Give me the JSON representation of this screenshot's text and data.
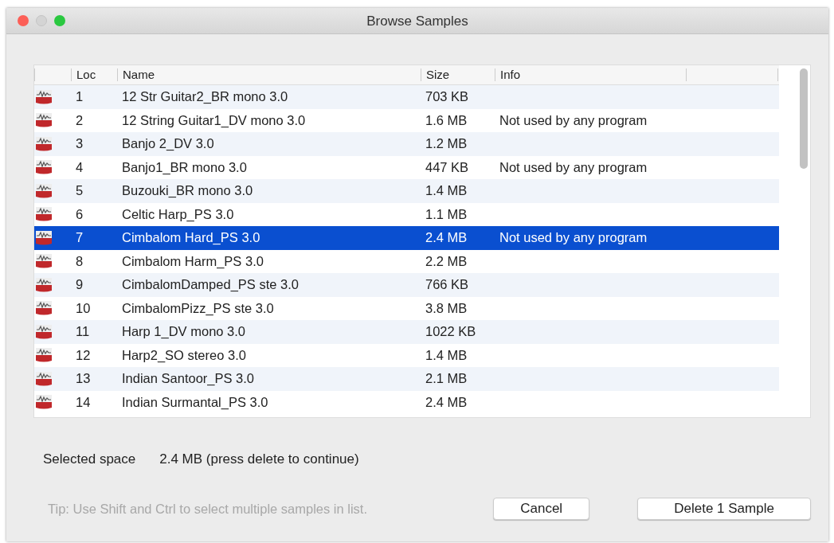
{
  "window": {
    "title": "Browse Samples"
  },
  "table": {
    "columns": [
      "Loc",
      "Name",
      "Size",
      "Info"
    ],
    "rows": [
      {
        "loc": "1",
        "name": "12 Str Guitar2_BR mono 3.0",
        "size": "703 KB",
        "info": "",
        "selected": false
      },
      {
        "loc": "2",
        "name": "12 String Guitar1_DV mono 3.0",
        "size": "1.6 MB",
        "info": "Not used by any program",
        "selected": false
      },
      {
        "loc": "3",
        "name": "Banjo 2_DV 3.0",
        "size": "1.2 MB",
        "info": "",
        "selected": false
      },
      {
        "loc": "4",
        "name": "Banjo1_BR mono 3.0",
        "size": "447 KB",
        "info": "Not used by any program",
        "selected": false
      },
      {
        "loc": "5",
        "name": "Buzouki_BR mono 3.0",
        "size": "1.4 MB",
        "info": "",
        "selected": false
      },
      {
        "loc": "6",
        "name": "Celtic Harp_PS 3.0",
        "size": "1.1 MB",
        "info": "",
        "selected": false
      },
      {
        "loc": "7",
        "name": "Cimbalom Hard_PS 3.0",
        "size": "2.4 MB",
        "info": "Not used by any program",
        "selected": true
      },
      {
        "loc": "8",
        "name": "Cimbalom Harm_PS 3.0",
        "size": "2.2 MB",
        "info": "",
        "selected": false
      },
      {
        "loc": "9",
        "name": "CimbalomDamped_PS ste 3.0",
        "size": "766 KB",
        "info": "",
        "selected": false
      },
      {
        "loc": "10",
        "name": "CimbalomPizz_PS ste 3.0",
        "size": "3.8 MB",
        "info": "",
        "selected": false
      },
      {
        "loc": "11",
        "name": "Harp 1_DV mono 3.0",
        "size": "1022 KB",
        "info": "",
        "selected": false
      },
      {
        "loc": "12",
        "name": "Harp2_SO stereo 3.0",
        "size": "1.4 MB",
        "info": "",
        "selected": false
      },
      {
        "loc": "13",
        "name": "Indian Santoor_PS 3.0",
        "size": "2.1 MB",
        "info": "",
        "selected": false
      },
      {
        "loc": "14",
        "name": "Indian Surmantal_PS 3.0",
        "size": "2.4 MB",
        "info": "",
        "selected": false
      }
    ]
  },
  "selected_space": {
    "label": "Selected space",
    "value": "2.4 MB (press delete to continue)"
  },
  "tip": "Tip: Use Shift and Ctrl to select multiple samples in list.",
  "buttons": [
    "Cancel",
    "Delete 1 Sample"
  ]
}
